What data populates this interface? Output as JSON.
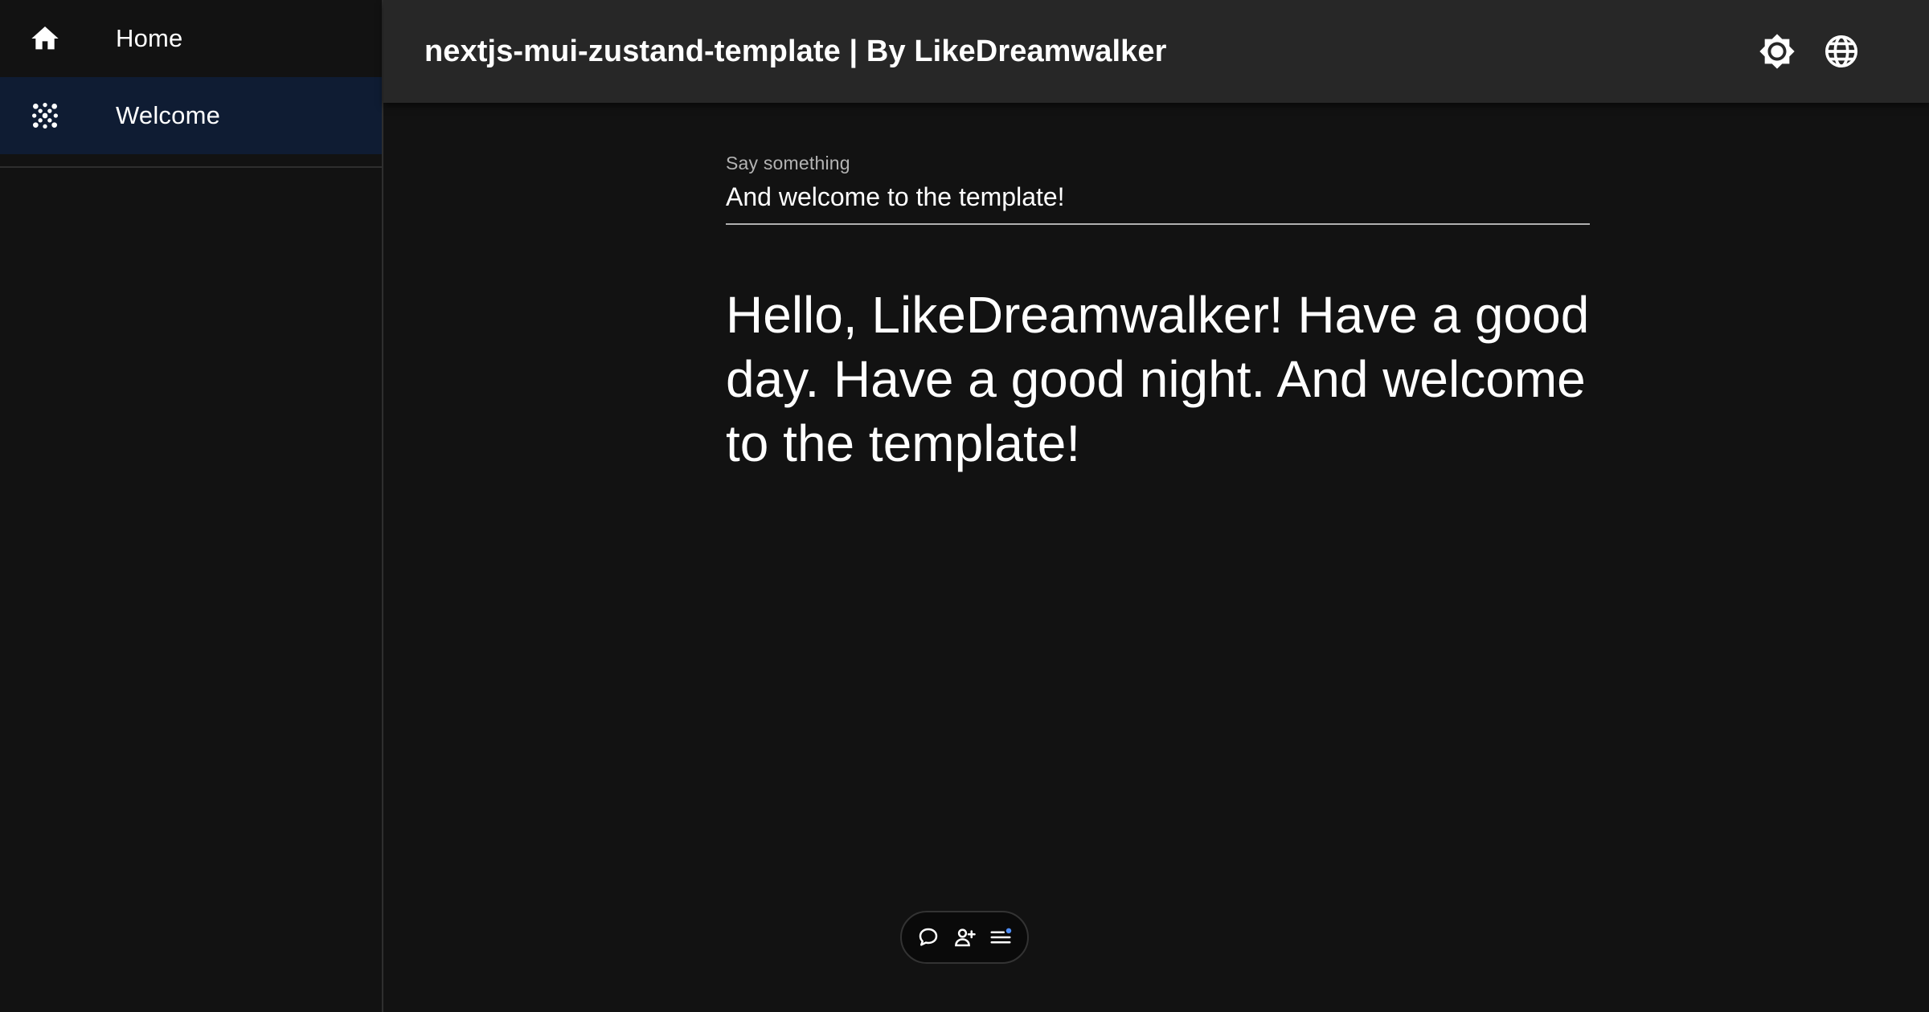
{
  "app": {
    "title": "nextjs-mui-zustand-template | By LikeDreamwalker"
  },
  "sidebar": {
    "items": [
      {
        "label": "Home",
        "icon": "home-icon",
        "selected": false
      },
      {
        "label": "Welcome",
        "icon": "dots-grid-icon",
        "selected": true
      }
    ]
  },
  "topbar": {
    "actions": [
      {
        "icon": "brightness-icon"
      },
      {
        "icon": "globe-icon"
      }
    ]
  },
  "main": {
    "input": {
      "label": "Say something",
      "value": "And welcome to the template!"
    },
    "greeting": "Hello, LikeDreamwalker! Have a good day. Have a good night. And welcome to the template!"
  },
  "floating_toolbar": {
    "buttons": [
      {
        "icon": "chat-bubble-icon"
      },
      {
        "icon": "add-user-icon"
      },
      {
        "icon": "menu-notification-icon"
      }
    ]
  },
  "colors": {
    "background": "#121212",
    "appbar": "#272727",
    "selected_nav": "#0f1c33",
    "notification_dot": "#4f8ef7"
  }
}
